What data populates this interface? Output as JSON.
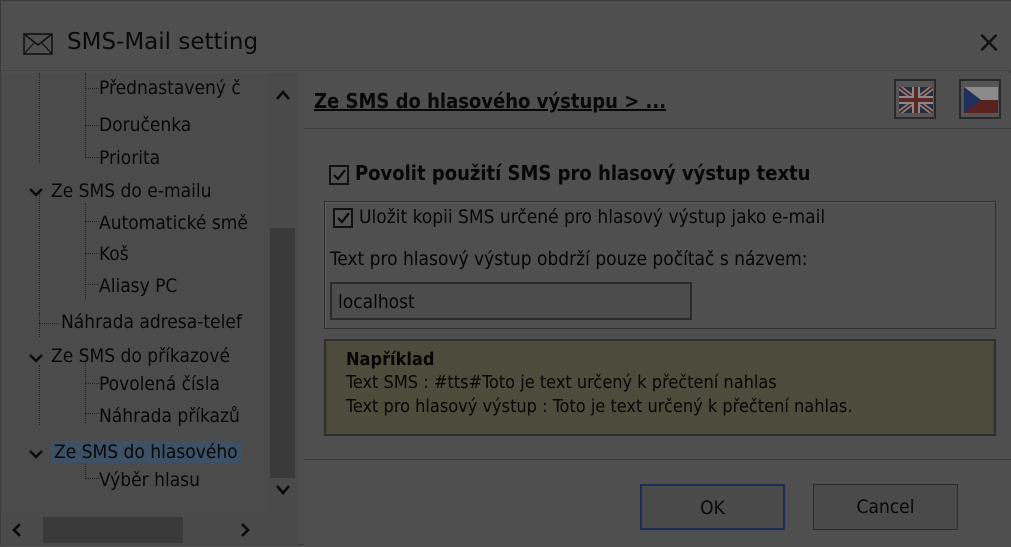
{
  "window": {
    "title": "SMS-Mail setting",
    "close_glyph": "×",
    "title_icon": "envelope-icon"
  },
  "tree": {
    "items": [
      {
        "label": "Přednastavený č",
        "level": 2
      },
      {
        "label": "Doručenka",
        "level": 2
      },
      {
        "label": "Priorita",
        "level": 2
      },
      {
        "label": "Ze SMS do e-mailu",
        "level": 1,
        "expanded": true
      },
      {
        "label": "Automatické smě",
        "level": 2
      },
      {
        "label": "Koš",
        "level": 2
      },
      {
        "label": "Aliasy PC",
        "level": 2
      },
      {
        "label": "Náhrada adresa-telef",
        "level": 1
      },
      {
        "label": "Ze SMS do příkazové",
        "level": 1,
        "expanded": true
      },
      {
        "label": "Povolená čísla",
        "level": 2
      },
      {
        "label": "Náhrada příkazů",
        "level": 2
      },
      {
        "label": "Ze SMS do hlasového",
        "level": 1,
        "expanded": true,
        "selected": true
      },
      {
        "label": "Výběr hlasu",
        "level": 2
      }
    ],
    "scroll_up": "^",
    "scroll_down": "v",
    "scroll_left": "<",
    "scroll_right": ">"
  },
  "content": {
    "breadcrumb": "Ze SMS do hlasového výstupu  >  ...",
    "flags": [
      {
        "name": "english-flag-icon"
      },
      {
        "name": "czech-flag-icon"
      }
    ],
    "enable_voice": {
      "label": "Povolit použití SMS pro hlasový výstup textu",
      "checked": true
    },
    "save_copy": {
      "label": "Uložit kopii SMS určené pro hlasový výstup jako e-mail",
      "checked": true
    },
    "computer_label": "Text pro hlasový výstup obdrží pouze počítač s názvem:",
    "computer_value": "localhost",
    "example": {
      "title": "Například",
      "line1": "Text SMS : #tts#Toto je text určený k přečtení nahlas",
      "line2": "Text pro hlasový výstup : Toto je text určený k přečtení nahlas."
    },
    "ok_label": "OK",
    "cancel_label": "Cancel"
  },
  "colors": {
    "background": "#4e4e4e",
    "selection": "#3d5066",
    "example_bg": "#4d4b3b",
    "ok_border": "#1c2d55"
  }
}
